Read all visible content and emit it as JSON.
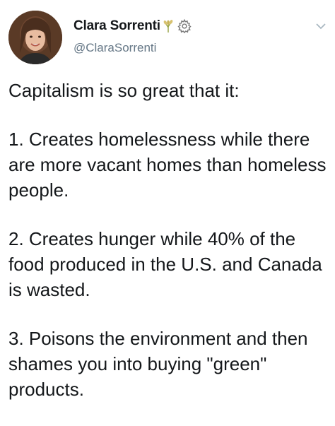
{
  "tweet": {
    "author": {
      "display_name": "Clara Sorrenti",
      "handle": "@ClaraSorrenti",
      "avatar_icon": "profile-photo",
      "name_badges": [
        "sheaf-of-rice-emoji",
        "gear-icon"
      ]
    },
    "menu_icon": "chevron-down-icon",
    "paragraphs": [
      "Capitalism is so great that it:",
      "1. Creates homelessness while there are more vacant homes than homeless people.",
      "2. Creates hunger while 40% of the food produced in the U.S. and Canada is wasted.",
      "3. Poisons the environment and then shames you into buying \"green\" products."
    ]
  },
  "colors": {
    "text": "#14171a",
    "secondary_text": "#657786",
    "background": "#ffffff"
  }
}
